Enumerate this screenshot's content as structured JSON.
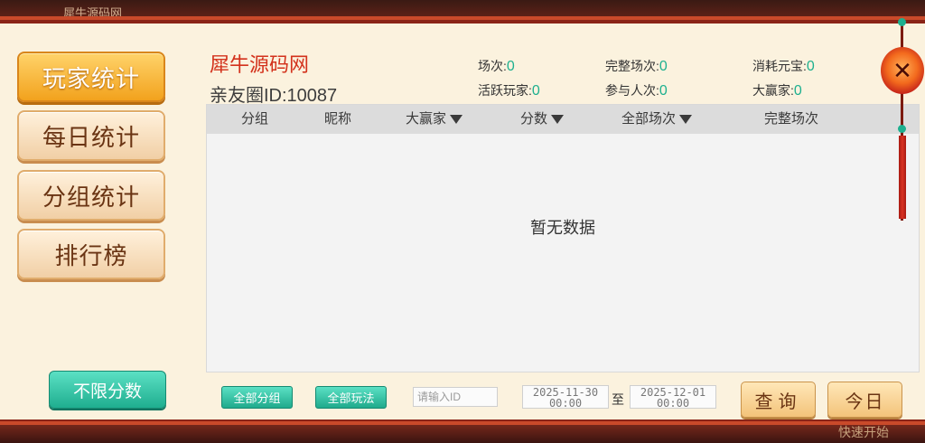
{
  "background": {
    "title": "犀牛源码网",
    "bottom_text": "快速开始"
  },
  "sidebar": {
    "items": [
      {
        "label": "玩家统计"
      },
      {
        "label": "每日统计"
      },
      {
        "label": "分组统计"
      },
      {
        "label": "排行榜"
      }
    ],
    "limit_button": "不限分数"
  },
  "header": {
    "site_name": "犀牛源码网",
    "club_id": "亲友圈ID:10087",
    "stats": [
      {
        "label": "场次:",
        "value": "0"
      },
      {
        "label": "完整场次:",
        "value": "0"
      },
      {
        "label": "消耗元宝:",
        "value": "0"
      },
      {
        "label": "活跃玩家:",
        "value": "0"
      },
      {
        "label": "参与人次:",
        "value": "0"
      },
      {
        "label": "大赢家:",
        "value": "0"
      }
    ]
  },
  "table": {
    "columns": [
      "分组",
      "昵称",
      "大赢家",
      "分数",
      "全部场次",
      "完整场次"
    ],
    "empty_text": "暂无数据"
  },
  "filters": {
    "group_button": "全部分组",
    "play_button": "全部玩法",
    "id_placeholder": "请输入ID",
    "start_date": "2025-11-30\n00:00",
    "to_label": "至",
    "end_date": "2025-12-01\n00:00",
    "query_button": "查询",
    "today_button": "今日"
  },
  "colors": {
    "accent_green": "#1db08f",
    "title_red": "#d3321c",
    "active_gold": "#f2a21d"
  },
  "icons": {
    "close": "close-icon",
    "dropdown": "triangle-down-icon"
  }
}
